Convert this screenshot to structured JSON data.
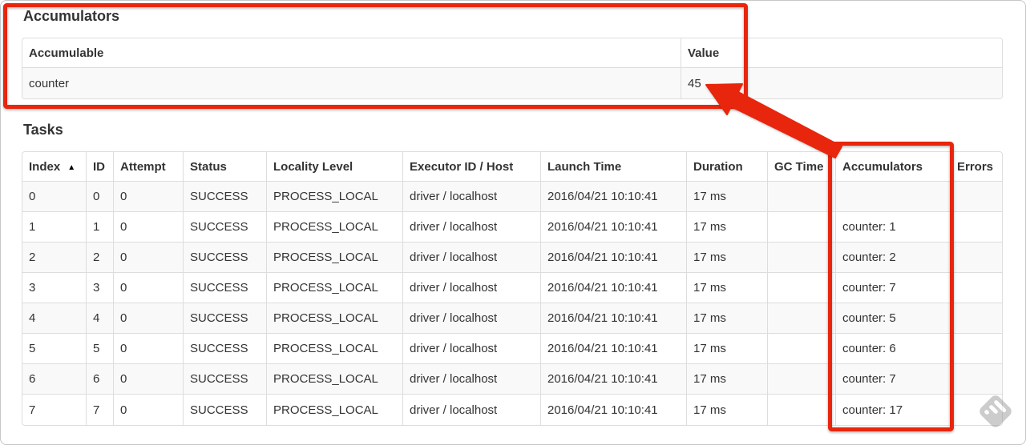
{
  "colors": {
    "annotation_red": "#e8260e",
    "table_border": "#dddddd",
    "row_stripe": "#f9f9f9",
    "text": "#333333",
    "watermark_grey": "#9b9b9b"
  },
  "accumulators_section": {
    "heading": "Accumulators",
    "table": {
      "headers": {
        "accumulable": "Accumulable",
        "value": "Value"
      },
      "rows": [
        {
          "accumulable": "counter",
          "value": "45"
        }
      ]
    }
  },
  "tasks_section": {
    "heading": "Tasks",
    "table": {
      "headers": {
        "index": "Index",
        "id": "ID",
        "attempt": "Attempt",
        "status": "Status",
        "locality": "Locality Level",
        "executor": "Executor ID / Host",
        "launch": "Launch Time",
        "duration": "Duration",
        "gc": "GC Time",
        "accumulators": "Accumulators",
        "errors": "Errors"
      },
      "sort": {
        "column": "Index",
        "direction": "ascending",
        "icon": "▲"
      },
      "rows": [
        {
          "index": "0",
          "id": "0",
          "attempt": "0",
          "status": "SUCCESS",
          "locality": "PROCESS_LOCAL",
          "executor": "driver / localhost",
          "launch": "2016/04/21 10:10:41",
          "duration": "17 ms",
          "gc": "",
          "accumulators": "",
          "errors": ""
        },
        {
          "index": "1",
          "id": "1",
          "attempt": "0",
          "status": "SUCCESS",
          "locality": "PROCESS_LOCAL",
          "executor": "driver / localhost",
          "launch": "2016/04/21 10:10:41",
          "duration": "17 ms",
          "gc": "",
          "accumulators": "counter: 1",
          "errors": ""
        },
        {
          "index": "2",
          "id": "2",
          "attempt": "0",
          "status": "SUCCESS",
          "locality": "PROCESS_LOCAL",
          "executor": "driver / localhost",
          "launch": "2016/04/21 10:10:41",
          "duration": "17 ms",
          "gc": "",
          "accumulators": "counter: 2",
          "errors": ""
        },
        {
          "index": "3",
          "id": "3",
          "attempt": "0",
          "status": "SUCCESS",
          "locality": "PROCESS_LOCAL",
          "executor": "driver / localhost",
          "launch": "2016/04/21 10:10:41",
          "duration": "17 ms",
          "gc": "",
          "accumulators": "counter: 7",
          "errors": ""
        },
        {
          "index": "4",
          "id": "4",
          "attempt": "0",
          "status": "SUCCESS",
          "locality": "PROCESS_LOCAL",
          "executor": "driver / localhost",
          "launch": "2016/04/21 10:10:41",
          "duration": "17 ms",
          "gc": "",
          "accumulators": "counter: 5",
          "errors": ""
        },
        {
          "index": "5",
          "id": "5",
          "attempt": "0",
          "status": "SUCCESS",
          "locality": "PROCESS_LOCAL",
          "executor": "driver / localhost",
          "launch": "2016/04/21 10:10:41",
          "duration": "17 ms",
          "gc": "",
          "accumulators": "counter: 6",
          "errors": ""
        },
        {
          "index": "6",
          "id": "6",
          "attempt": "0",
          "status": "SUCCESS",
          "locality": "PROCESS_LOCAL",
          "executor": "driver / localhost",
          "launch": "2016/04/21 10:10:41",
          "duration": "17 ms",
          "gc": "",
          "accumulators": "counter: 7",
          "errors": ""
        },
        {
          "index": "7",
          "id": "7",
          "attempt": "0",
          "status": "SUCCESS",
          "locality": "PROCESS_LOCAL",
          "executor": "driver / localhost",
          "launch": "2016/04/21 10:10:41",
          "duration": "17 ms",
          "gc": "",
          "accumulators": "counter: 17",
          "errors": ""
        }
      ]
    }
  }
}
